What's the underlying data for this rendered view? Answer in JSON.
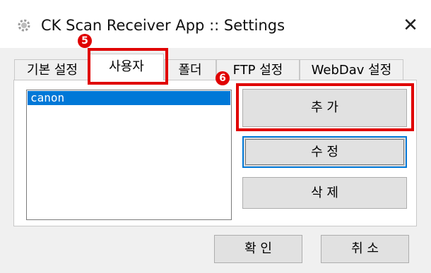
{
  "window": {
    "title": "CK Scan Receiver App :: Settings",
    "close_glyph": "✕",
    "app_icon": "gear-icon"
  },
  "tabs": [
    {
      "label": "기본 설정",
      "active": false
    },
    {
      "label": "사용자",
      "active": true
    },
    {
      "label": "폴더",
      "active": false
    },
    {
      "label": "FTP 설정",
      "active": false
    },
    {
      "label": "WebDav 설정",
      "active": false
    }
  ],
  "users": {
    "items": [
      "canon"
    ],
    "selected": "canon"
  },
  "buttons": {
    "add": "추 가",
    "edit": "수 정",
    "delete": "삭 제",
    "ok": "확 인",
    "cancel": "취 소"
  },
  "annotations": {
    "step5": "5",
    "step6": "6",
    "color": "#e00000"
  },
  "colors": {
    "selection": "#0078d7",
    "focus": "#0078d7"
  }
}
